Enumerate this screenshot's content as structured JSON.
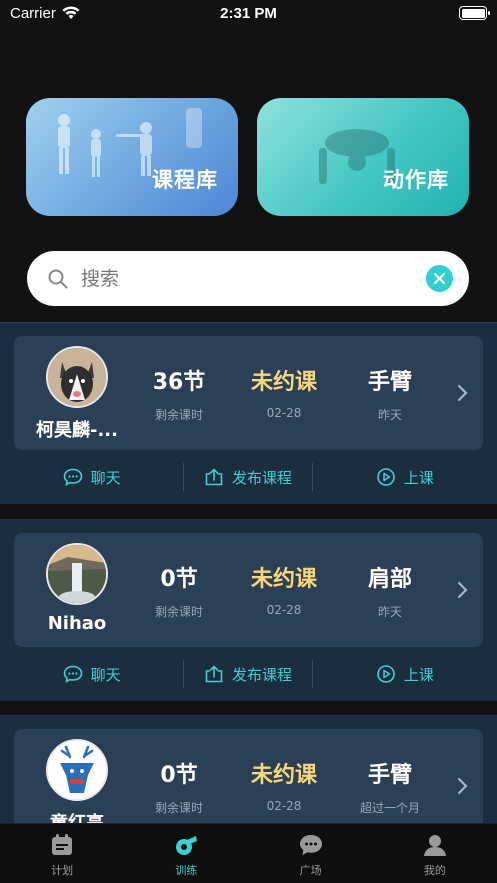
{
  "status_bar": {
    "carrier": "Carrier",
    "time": "2:31 PM"
  },
  "libraries": {
    "course": "课程库",
    "action": "动作库"
  },
  "search": {
    "placeholder": "搜索",
    "value": ""
  },
  "students": [
    {
      "name": "柯昊麟-...",
      "avatar": "dog-avatar",
      "remaining": "36节",
      "remaining_label": "剩余课时",
      "status": "未约课",
      "status_date": "02-28",
      "part": "手臂",
      "part_time": "昨天"
    },
    {
      "name": "Nihao",
      "avatar": "waterfall-avatar",
      "remaining": "0节",
      "remaining_label": "剩余课时",
      "status": "未约课",
      "status_date": "02-28",
      "part": "肩部",
      "part_time": "昨天"
    },
    {
      "name": "童红亮",
      "avatar": "deer-avatar",
      "remaining": "0节",
      "remaining_label": "剩余课时",
      "status": "未约课",
      "status_date": "02-28",
      "part": "手臂",
      "part_time": "超过一个月"
    }
  ],
  "actions": {
    "chat": "聊天",
    "publish": "发布课程",
    "start": "上课"
  },
  "tabs": [
    {
      "label": "计划",
      "icon": "calendar-icon"
    },
    {
      "label": "训练",
      "icon": "whistle-icon"
    },
    {
      "label": "广场",
      "icon": "chat-bubble-icon"
    },
    {
      "label": "我的",
      "icon": "user-icon"
    }
  ],
  "colors": {
    "accent": "#3fd0d0",
    "status_yellow": "#f6d77a",
    "card_bg": "#2b3f57"
  }
}
